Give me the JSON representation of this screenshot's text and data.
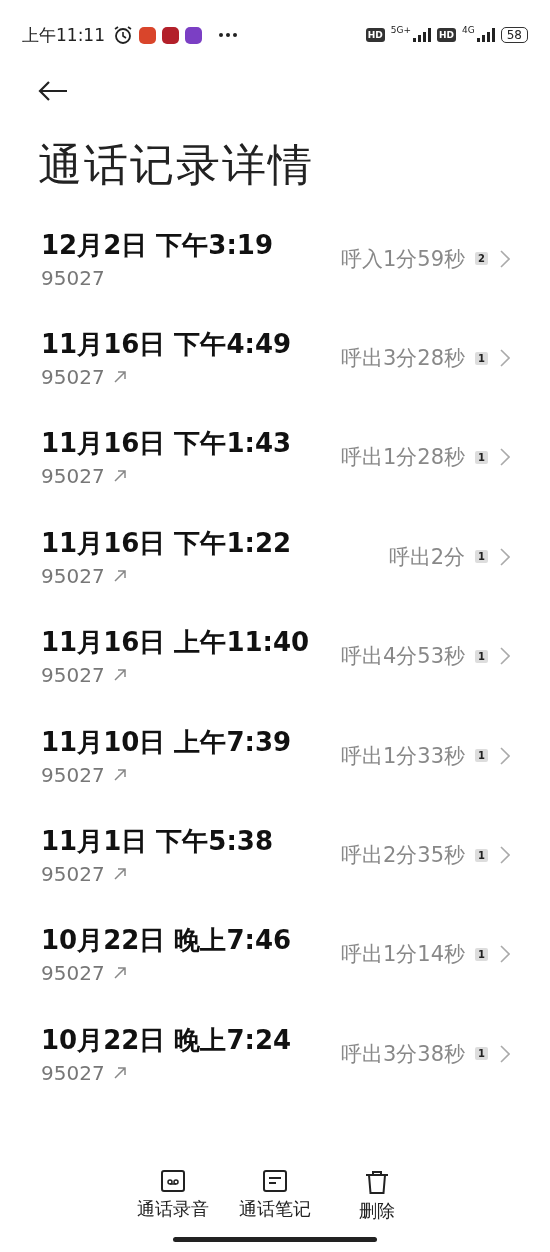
{
  "status_bar": {
    "time": "上午11:11",
    "network_1": "5G+",
    "network_2": "4G",
    "hd_1": "HD",
    "hd_2": "HD",
    "battery": "58"
  },
  "title": "通话记录详情",
  "calls": [
    {
      "date": "12月2日 下午3:19",
      "number": "95027",
      "kind": "incoming",
      "summary": "呼入1分59秒",
      "sim": "2"
    },
    {
      "date": "11月16日 下午4:49",
      "number": "95027",
      "kind": "outgoing",
      "summary": "呼出3分28秒",
      "sim": "1"
    },
    {
      "date": "11月16日 下午1:43",
      "number": "95027",
      "kind": "outgoing",
      "summary": "呼出1分28秒",
      "sim": "1"
    },
    {
      "date": "11月16日 下午1:22",
      "number": "95027",
      "kind": "outgoing",
      "summary": "呼出2分",
      "sim": "1"
    },
    {
      "date": "11月16日 上午11:40",
      "number": "95027",
      "kind": "outgoing",
      "summary": "呼出4分53秒",
      "sim": "1"
    },
    {
      "date": "11月10日 上午7:39",
      "number": "95027",
      "kind": "outgoing",
      "summary": "呼出1分33秒",
      "sim": "1"
    },
    {
      "date": "11月1日 下午5:38",
      "number": "95027",
      "kind": "outgoing",
      "summary": "呼出2分35秒",
      "sim": "1"
    },
    {
      "date": "10月22日 晚上7:46",
      "number": "95027",
      "kind": "outgoing",
      "summary": "呼出1分14秒",
      "sim": "1"
    },
    {
      "date": "10月22日 晚上7:24",
      "number": "95027",
      "kind": "outgoing",
      "summary": "呼出3分38秒",
      "sim": "1"
    }
  ],
  "actions": [
    {
      "label": "通话录音",
      "kind": "recording"
    },
    {
      "label": "通话笔记",
      "kind": "note"
    },
    {
      "label": "删除",
      "kind": "delete"
    }
  ]
}
